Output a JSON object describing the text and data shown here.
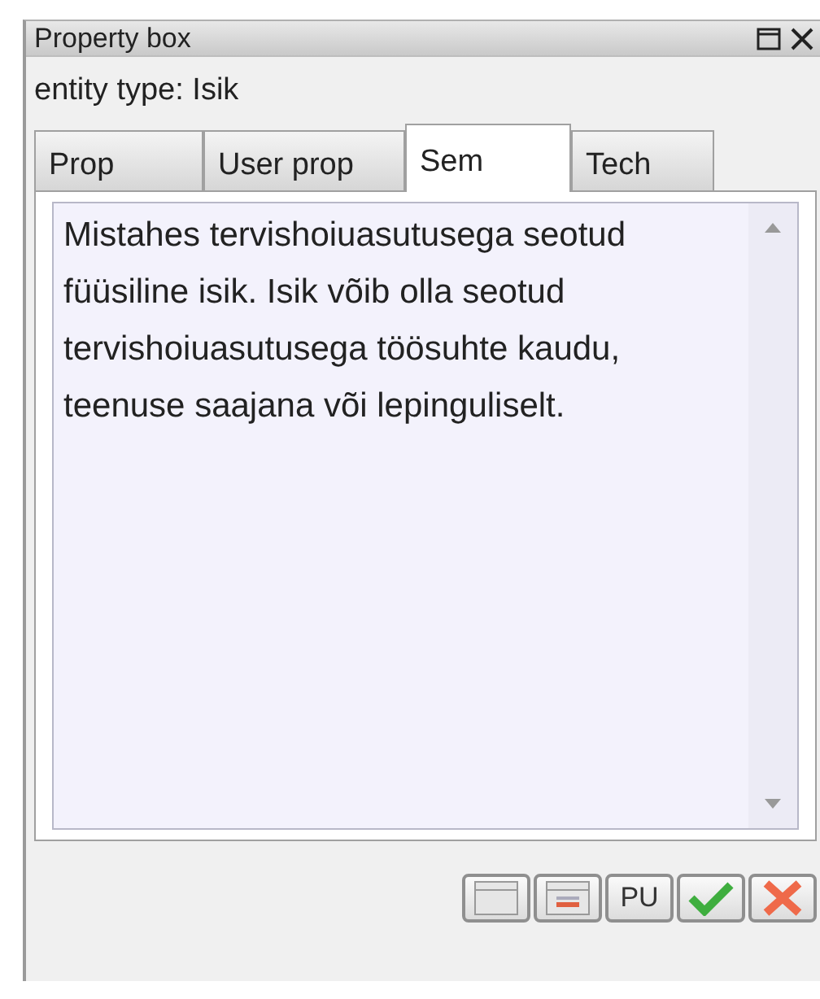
{
  "window": {
    "title": "Property box"
  },
  "entity_type": "entity type: Isik",
  "tabs": [
    {
      "label": "Prop",
      "selected": false
    },
    {
      "label": "User prop",
      "selected": false
    },
    {
      "label": "Sem",
      "selected": true
    },
    {
      "label": "Tech",
      "selected": false
    }
  ],
  "description": "Mistahes tervishoiuasutusega seotud füüsiline isik. Isik võib olla seotud tervishoiuasutusega töösuhte kaudu, teenuse saajana või lepinguliselt.",
  "buttons": [
    {
      "kind": "form"
    },
    {
      "kind": "form-remove"
    },
    {
      "kind": "text",
      "label": "PU"
    },
    {
      "kind": "ok"
    },
    {
      "kind": "cancel"
    }
  ]
}
